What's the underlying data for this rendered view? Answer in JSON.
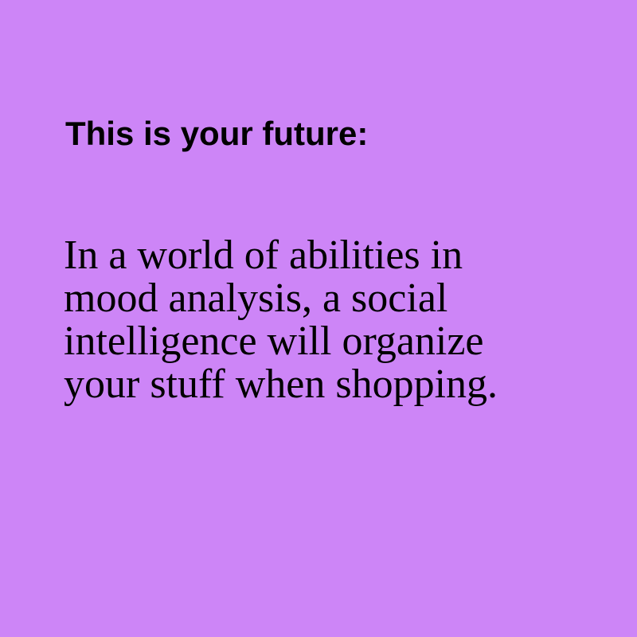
{
  "colors": {
    "background": "#cd85f7",
    "text": "#000000"
  },
  "card": {
    "heading": "This is your future:",
    "body_lines": [
      "In a world of abilities in",
      "mood analysis, a social",
      "intelligence will organize",
      "your stuff when shopping."
    ]
  }
}
